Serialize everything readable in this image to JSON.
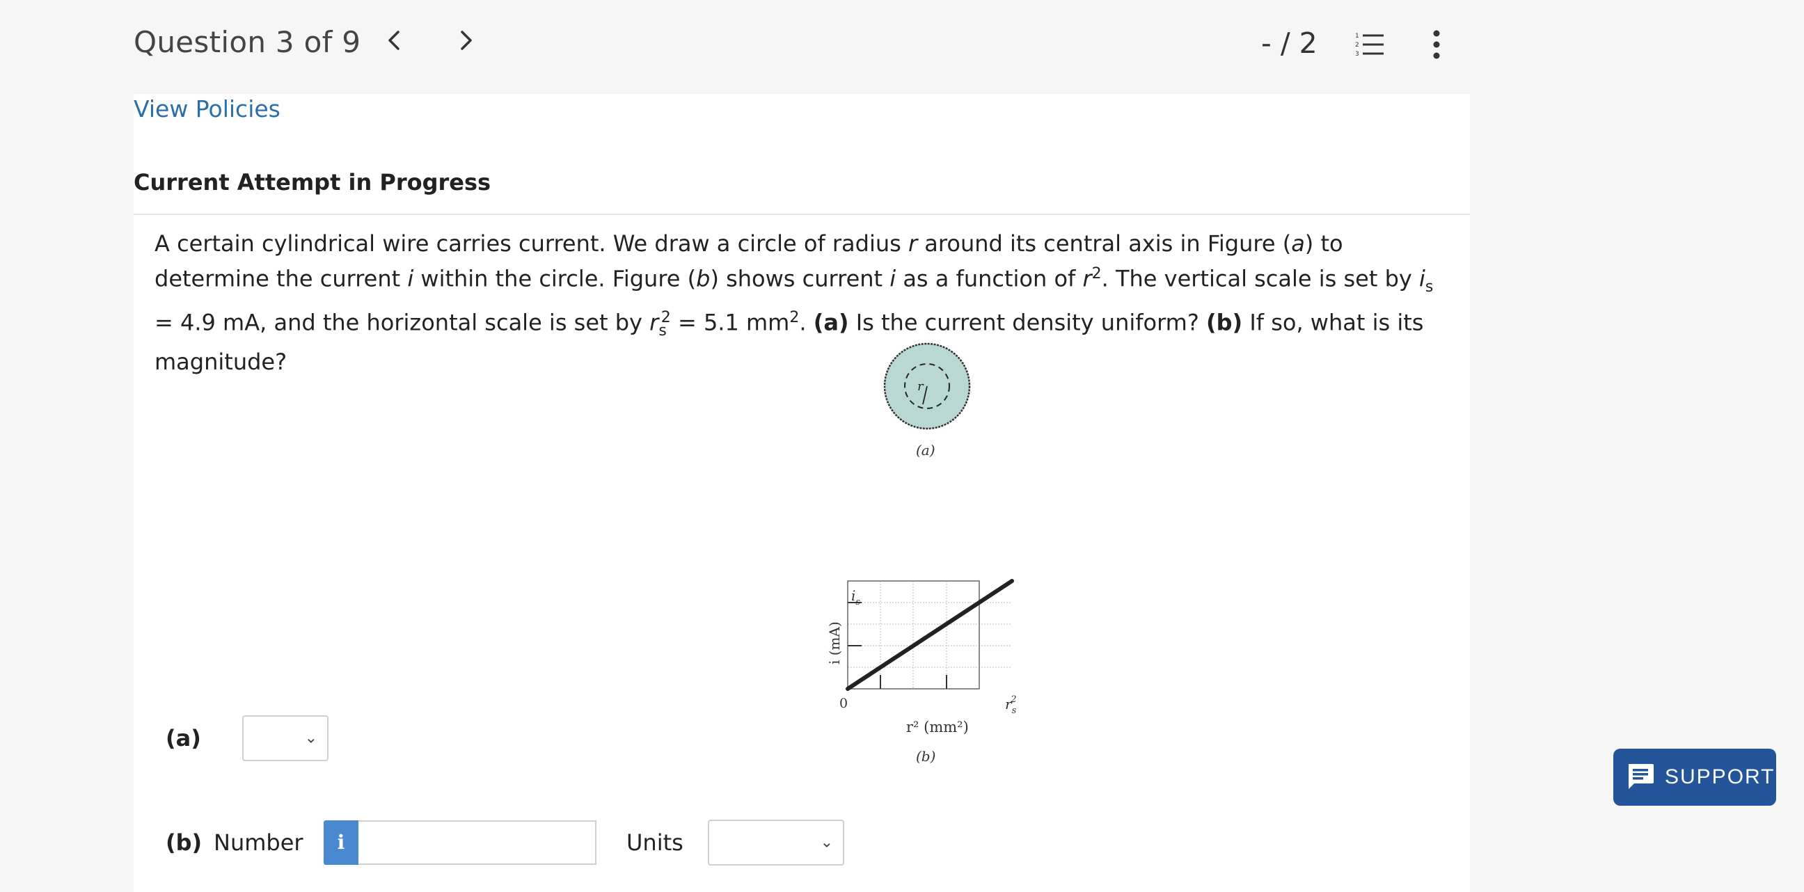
{
  "header": {
    "question_counter": "Question 3 of 9",
    "prev_icon": "chevron-left-icon",
    "next_icon": "chevron-right-icon",
    "score": "- / 2",
    "list_icon": "numbered-list-icon",
    "more_icon": "more-vertical-icon"
  },
  "policies_link": "View Policies",
  "attempt_heading": "Current Attempt in Progress",
  "question": {
    "p1": "A certain cylindrical wire carries current. We draw a circle of radius ",
    "v_r": "r",
    "p2": " around its central axis in Figure (",
    "v_a": "a",
    "p3": ") to determine the current ",
    "v_i": "i",
    "p4": " within the circle. Figure (",
    "v_b": "b",
    "p5": ") shows current ",
    "v_i2": "i",
    "p6": " as a function of ",
    "v_r2": "r",
    "sup2": "2",
    "p7": ". The vertical scale is set by ",
    "v_is": "i",
    "sub_s": "s",
    "p8": " = 4.9 mA, and the horizontal scale is set by ",
    "v_rs": "r",
    "sub_s2": "s",
    "sup_rs": "2",
    "p9": " = 5.1 mm",
    "sup_mm": "2",
    "p10": ". ",
    "bold_a": "(a)",
    "p11": " Is the current density uniform? ",
    "bold_b": "(b)",
    "p12": " If so, what is its magnitude?"
  },
  "figure_a": {
    "radius_label": "r",
    "caption": "(a)"
  },
  "figure_b": {
    "y_axis_label": "i (mA)",
    "y_tick_label": "i",
    "y_tick_sub": "s",
    "origin_label": "0",
    "x_tick_label": "r",
    "x_tick_sub": "s",
    "x_tick_sup": "2",
    "x_axis_label": "r² (mm²)",
    "caption": "(b)"
  },
  "answers": {
    "part_a_label": "(a)",
    "part_a_selected": "",
    "part_b_label": "(b)",
    "number_label": "Number",
    "info_icon_text": "i",
    "number_value": "",
    "units_label": "Units",
    "units_selected": ""
  },
  "support": {
    "label": "SUPPORT",
    "icon": "chat-icon",
    "color": "#24549a"
  }
}
